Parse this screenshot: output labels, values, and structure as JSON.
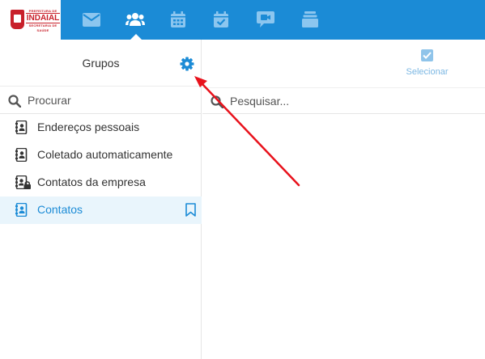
{
  "logo": {
    "top_text": "PREFEITURA DE",
    "city": "INDAIAL",
    "subtitle": "SECRETARIA DE SAÚDE"
  },
  "nav": {
    "items": [
      {
        "icon": "mail-icon",
        "active": false
      },
      {
        "icon": "contacts-icon",
        "active": true
      },
      {
        "icon": "calendar-icon",
        "active": false
      },
      {
        "icon": "tasks-icon",
        "active": false
      },
      {
        "icon": "video-chat-icon",
        "active": false
      },
      {
        "icon": "files-icon",
        "active": false
      }
    ]
  },
  "groups": {
    "title": "Grupos",
    "settings_icon": "gear-icon"
  },
  "left_search": {
    "placeholder": "Procurar"
  },
  "address_books": [
    {
      "label": "Endereços pessoais",
      "icon": "address-book-icon",
      "active": false
    },
    {
      "label": "Coletado automaticamente",
      "icon": "address-book-icon",
      "active": false
    },
    {
      "label": "Contatos da empresa",
      "icon": "address-book-locked-icon",
      "active": false
    },
    {
      "label": "Contatos",
      "icon": "address-book-icon",
      "active": true,
      "bookmarked": true
    }
  ],
  "toolbar": {
    "select_label": "Selecionar"
  },
  "right_search": {
    "placeholder": "Pesquisar..."
  },
  "colors": {
    "topbar": "#1b8bd6",
    "nav_icon": "#8cc6ef",
    "accent": "#1b8bd6",
    "active_row": "#e9f5fc",
    "annotation_arrow": "#e8121c"
  }
}
